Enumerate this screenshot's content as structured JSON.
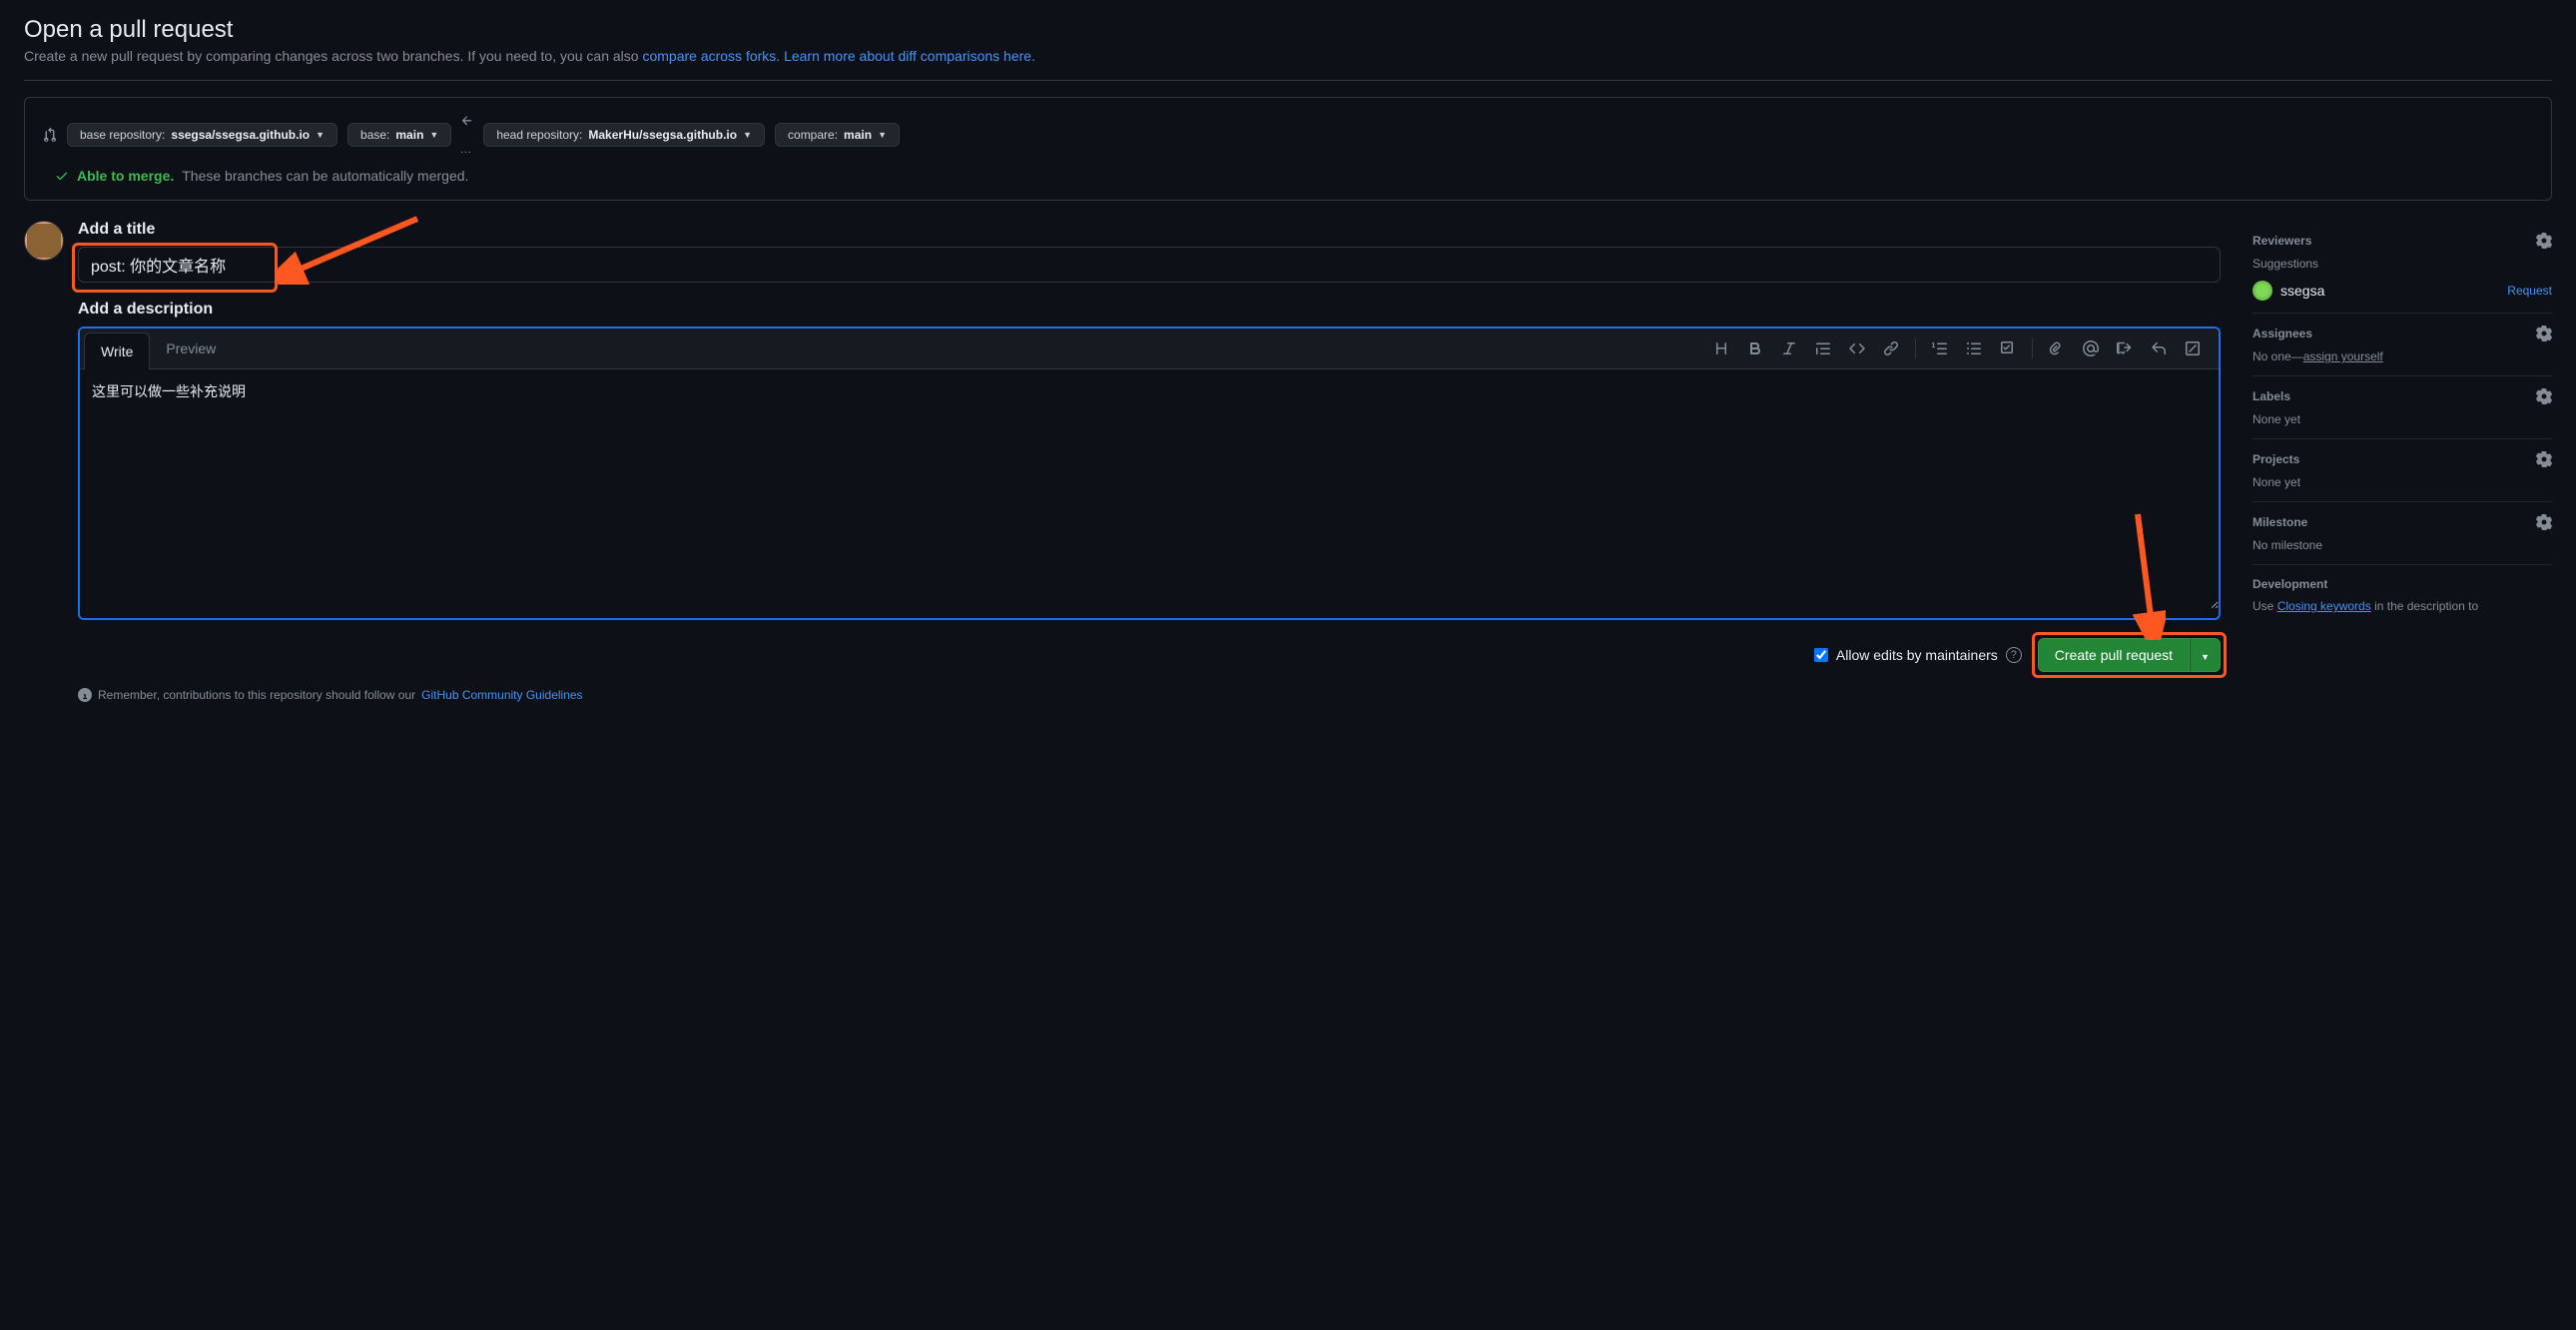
{
  "header": {
    "title": "Open a pull request",
    "subtitle_prefix": "Create a new pull request by comparing changes across two branches. If you need to, you can also ",
    "link1": "compare across forks",
    "subtitle_mid": ". ",
    "link2": "Learn more about diff comparisons here.",
    "subtitle_suffix": ""
  },
  "compare": {
    "base_repo_label": "base repository: ",
    "base_repo_value": "ssegsa/ssegsa.github.io",
    "base_branch_label": "base: ",
    "base_branch_value": "main",
    "head_repo_label": "head repository: ",
    "head_repo_value": "MakerHu/ssegsa.github.io",
    "compare_branch_label": "compare: ",
    "compare_branch_value": "main",
    "merge_able": "Able to merge.",
    "merge_text": "These branches can be automatically merged."
  },
  "form": {
    "title_label": "Add a title",
    "title_value": "post: 你的文章名称",
    "description_label": "Add a description",
    "tab_write": "Write",
    "tab_preview": "Preview",
    "description_value": "这里可以做一些补充说明",
    "allow_edits_label": "Allow edits by maintainers",
    "submit_label": "Create pull request",
    "remember_prefix": "Remember, contributions to this repository should follow our ",
    "remember_link": "GitHub Community Guidelines"
  },
  "sidebar": {
    "reviewers": {
      "title": "Reviewers",
      "suggestions_label": "Suggestions",
      "user": "ssegsa",
      "request": "Request"
    },
    "assignees": {
      "title": "Assignees",
      "no_one": "No one—",
      "assign_yourself": "assign yourself"
    },
    "labels": {
      "title": "Labels",
      "none": "None yet"
    },
    "projects": {
      "title": "Projects",
      "none": "None yet"
    },
    "milestone": {
      "title": "Milestone",
      "none": "No milestone"
    },
    "development": {
      "title": "Development",
      "use_prefix": "Use ",
      "closing_keywords": "Closing keywords",
      "use_suffix": " in the description to"
    }
  }
}
